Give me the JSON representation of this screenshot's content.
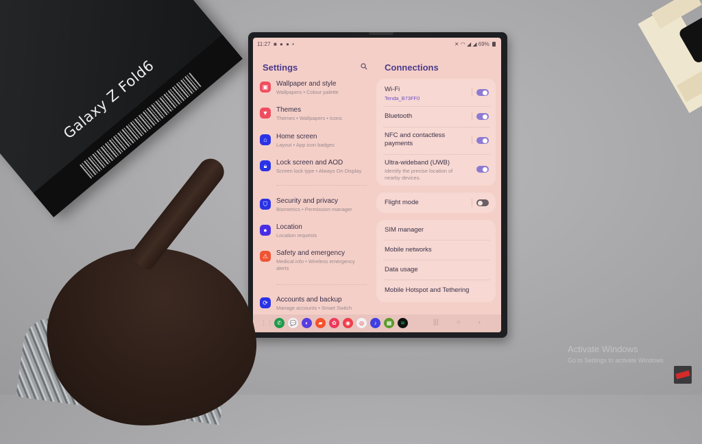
{
  "scene": {
    "box_title": "Galaxy Z Fold6",
    "watermark": {
      "line1": "Activate Windows",
      "line2": "Go to Settings to activate Windows."
    }
  },
  "status_bar": {
    "time": "11:27",
    "notifications": "■ ● ● •",
    "battery": "69%"
  },
  "settings": {
    "title": "Settings",
    "search_icon": "search-icon",
    "items": [
      {
        "title": "Wallpaper and style",
        "subtitle": "Wallpapers  •  Colour palette",
        "icon": "wallpaper-icon",
        "color": "#ef4d5e"
      },
      {
        "title": "Themes",
        "subtitle": "Themes  •  Wallpapers  •  Icons",
        "icon": "themes-icon",
        "color": "#ef4d5e"
      },
      {
        "title": "Home screen",
        "subtitle": "Layout  •  App icon badges",
        "icon": "home-icon",
        "color": "#2a32e6"
      },
      {
        "title": "Lock screen and AOD",
        "subtitle": "Screen lock type  •  Always On Display",
        "icon": "lock-icon",
        "color": "#2a32e6"
      },
      {
        "title": "Security and privacy",
        "subtitle": "Biometrics  •  Permission manager",
        "icon": "shield-icon",
        "color": "#2a32e6"
      },
      {
        "title": "Location",
        "subtitle": "Location requests",
        "icon": "location-icon",
        "color": "#4a2ee6"
      },
      {
        "title": "Safety and emergency",
        "subtitle": "Medical info  •  Wireless emergency alerts",
        "icon": "emergency-icon",
        "color": "#ef5434"
      },
      {
        "title": "Accounts and backup",
        "subtitle": "Manage accounts  •  Smart Switch",
        "icon": "sync-icon",
        "color": "#2a32e6"
      }
    ]
  },
  "connections": {
    "title": "Connections",
    "group1": [
      {
        "label": "Wi-Fi",
        "sub": "Tenda_B73FF0",
        "sub_color": "#6f4fc8",
        "toggle": true
      },
      {
        "label": "Bluetooth",
        "toggle": true
      },
      {
        "label": "NFC and contactless payments",
        "toggle": true
      },
      {
        "label": "Ultra-wideband (UWB)",
        "sub": "Identify the precise location of nearby devices.",
        "sub_color": "#9a8a8e",
        "toggle": true
      }
    ],
    "flight_mode": {
      "label": "Flight mode",
      "toggle": false
    },
    "group3": [
      {
        "label": "SIM manager"
      },
      {
        "label": "Mobile networks"
      },
      {
        "label": "Data usage"
      },
      {
        "label": "Mobile Hotspot and Tethering"
      }
    ]
  },
  "taskbar": {
    "apps": [
      {
        "name": "phone",
        "color": "#1f9a4a",
        "glyph": "✆"
      },
      {
        "name": "messages",
        "color": "#f5f0f3",
        "glyph": "💬"
      },
      {
        "name": "internet",
        "color": "#5a3de0",
        "glyph": "◐"
      },
      {
        "name": "notes",
        "color": "#f4512c",
        "glyph": "▰"
      },
      {
        "name": "gallery",
        "color": "#ef3a5b",
        "glyph": "✿"
      },
      {
        "name": "camera",
        "color": "#ef3d4a",
        "glyph": "◉"
      },
      {
        "name": "youtube-music",
        "color": "#f2f2f2",
        "glyph": "◎"
      },
      {
        "name": "samsung-music",
        "color": "#3f3fe0",
        "glyph": "♪"
      },
      {
        "name": "game-launcher",
        "color": "#5a9a2a",
        "glyph": "▦"
      },
      {
        "name": "spotify",
        "color": "#111111",
        "glyph": "≋"
      }
    ],
    "nav": {
      "recents": "|||",
      "home": "○",
      "back": "‹"
    }
  }
}
